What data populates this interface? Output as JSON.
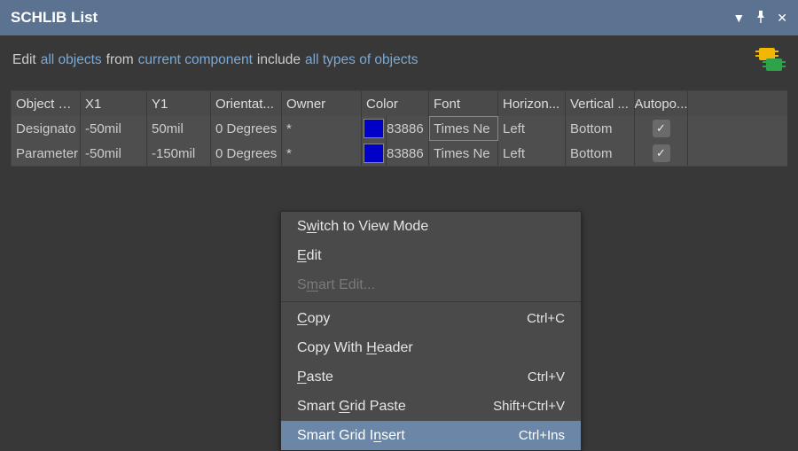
{
  "titlebar": {
    "title": "SCHLIB List"
  },
  "filter": {
    "edit_label": "Edit",
    "scope_link": "all objects",
    "from_label": "from",
    "source_link": "current component",
    "include_label": "include",
    "types_link": "all types of objects"
  },
  "grid": {
    "columns": {
      "object_kind": "Object …",
      "x1": "X1",
      "y1": "Y1",
      "orientation": "Orientat...",
      "owner": "Owner",
      "color": "Color",
      "font": "Font",
      "hjust": "Horizon...",
      "vjust": "Vertical ...",
      "autopos": "Autopo..."
    },
    "rows": [
      {
        "object_kind": "Designato",
        "x1": "-50mil",
        "y1": "50mil",
        "orientation": "0 Degrees",
        "owner": "*",
        "color_hex": "#0000c8",
        "color_num": "83886",
        "font": "Times Ne",
        "hjust": "Left",
        "vjust": "Bottom",
        "autopos": true
      },
      {
        "object_kind": "Parameter",
        "x1": "-50mil",
        "y1": "-150mil",
        "orientation": "0 Degrees",
        "owner": "*",
        "color_hex": "#0000c8",
        "color_num": "83886",
        "font": "Times Ne",
        "hjust": "Left",
        "vjust": "Bottom",
        "autopos": true
      }
    ]
  },
  "context_menu": {
    "items": [
      {
        "label_pre": "S",
        "mnemonic": "w",
        "label_post": "itch to View Mode",
        "shortcut": "",
        "disabled": false,
        "highlight": false
      },
      {
        "label_pre": "",
        "mnemonic": "E",
        "label_post": "dit",
        "shortcut": "",
        "disabled": false,
        "highlight": false
      },
      {
        "label_pre": "S",
        "mnemonic": "m",
        "label_post": "art Edit...",
        "shortcut": "",
        "disabled": true,
        "highlight": false
      },
      {
        "sep": true
      },
      {
        "label_pre": "",
        "mnemonic": "C",
        "label_post": "opy",
        "shortcut": "Ctrl+C",
        "disabled": false,
        "highlight": false
      },
      {
        "label_pre": "Copy With ",
        "mnemonic": "H",
        "label_post": "eader",
        "shortcut": "",
        "disabled": false,
        "highlight": false
      },
      {
        "label_pre": "",
        "mnemonic": "P",
        "label_post": "aste",
        "shortcut": "Ctrl+V",
        "disabled": false,
        "highlight": false
      },
      {
        "label_pre": "Smart ",
        "mnemonic": "G",
        "label_post": "rid Paste",
        "shortcut": "Shift+Ctrl+V",
        "disabled": false,
        "highlight": false
      },
      {
        "label_pre": "Smart Grid I",
        "mnemonic": "n",
        "label_post": "sert",
        "shortcut": "Ctrl+Ins",
        "disabled": false,
        "highlight": true
      }
    ]
  }
}
